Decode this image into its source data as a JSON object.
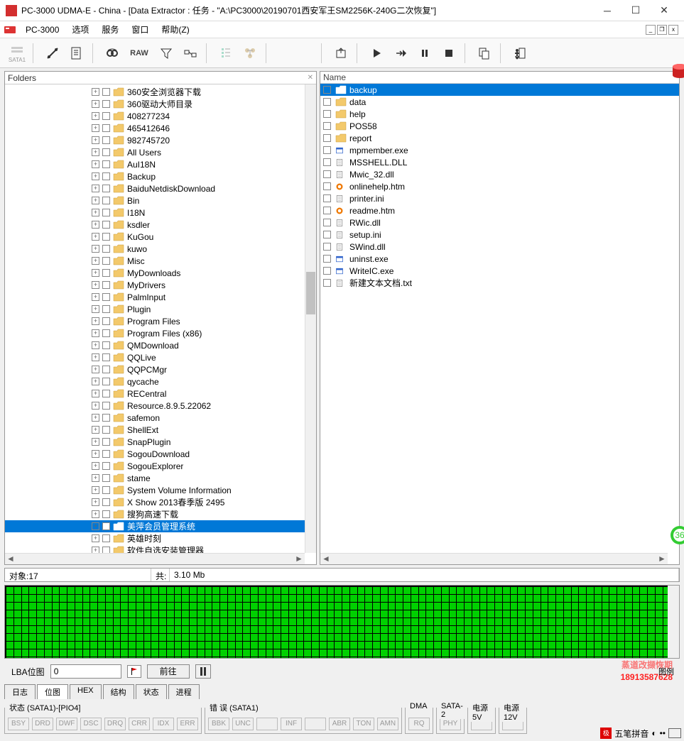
{
  "window": {
    "title": "PC-3000 UDMA-E - China - [Data Extractor : 任务 - \"A:\\PC3000\\20190701西安军王SM2256K-240G二次恢复\"]"
  },
  "menu": {
    "app": "PC-3000",
    "items": [
      "选项",
      "服务",
      "窗口",
      "帮助(Z)"
    ]
  },
  "toolbar_raw": "RAW",
  "folders_panel": {
    "title": "Folders"
  },
  "tree": [
    {
      "label": "360安全浏览器下载"
    },
    {
      "label": "360驱动大师目录"
    },
    {
      "label": "408277234"
    },
    {
      "label": "465412646"
    },
    {
      "label": "982745720"
    },
    {
      "label": "All Users"
    },
    {
      "label": "AuI18N"
    },
    {
      "label": "Backup"
    },
    {
      "label": "BaiduNetdiskDownload"
    },
    {
      "label": "Bin"
    },
    {
      "label": "I18N"
    },
    {
      "label": "ksdler"
    },
    {
      "label": "KuGou"
    },
    {
      "label": "kuwo"
    },
    {
      "label": "Misc"
    },
    {
      "label": "MyDownloads"
    },
    {
      "label": "MyDrivers"
    },
    {
      "label": "PalmInput"
    },
    {
      "label": "Plugin"
    },
    {
      "label": "Program Files"
    },
    {
      "label": "Program Files (x86)"
    },
    {
      "label": "QMDownload"
    },
    {
      "label": "QQLive"
    },
    {
      "label": "QQPCMgr"
    },
    {
      "label": "qycache"
    },
    {
      "label": "RECentral"
    },
    {
      "label": "Resource.8.9.5.22062"
    },
    {
      "label": "safemon"
    },
    {
      "label": "ShellExt"
    },
    {
      "label": "SnapPlugin"
    },
    {
      "label": "SogouDownload"
    },
    {
      "label": "SogouExplorer"
    },
    {
      "label": "stame"
    },
    {
      "label": "System Volume Information"
    },
    {
      "label": "X Show 2013春季版 2495"
    },
    {
      "label": "搜狗高速下载"
    },
    {
      "label": "美萍会员管理系统",
      "selected": true
    },
    {
      "label": "英雄时刻"
    },
    {
      "label": "软件自选安装管理器"
    }
  ],
  "list_header": "Name",
  "list": [
    {
      "name": "backup",
      "type": "folder",
      "selected": true
    },
    {
      "name": "data",
      "type": "folder"
    },
    {
      "name": "help",
      "type": "folder"
    },
    {
      "name": "POS58",
      "type": "folder"
    },
    {
      "name": "report",
      "type": "folder"
    },
    {
      "name": "mpmember.exe",
      "type": "exe"
    },
    {
      "name": "MSSHELL.DLL",
      "type": "dll"
    },
    {
      "name": "Mwic_32.dll",
      "type": "dll"
    },
    {
      "name": "onlinehelp.htm",
      "type": "htm"
    },
    {
      "name": "printer.ini",
      "type": "ini"
    },
    {
      "name": "readme.htm",
      "type": "htm"
    },
    {
      "name": "RWic.dll",
      "type": "dll"
    },
    {
      "name": "setup.ini",
      "type": "ini"
    },
    {
      "name": "SWind.dll",
      "type": "dll"
    },
    {
      "name": "uninst.exe",
      "type": "exe"
    },
    {
      "name": "WriteIC.exe",
      "type": "exe"
    },
    {
      "name": "新建文本文档.txt",
      "type": "txt"
    }
  ],
  "status": {
    "objects_label": "对象:",
    "objects_value": "17",
    "total_label": "共:",
    "total_value": "3.10 Mb"
  },
  "lba": {
    "label": "LBA位图",
    "value": "0",
    "go": "前往",
    "legend_right": "图例"
  },
  "watermark": {
    "line1": "蒸道改撷恢期",
    "phone": "18913587628"
  },
  "tabs": [
    "日志",
    "位图",
    "HEX",
    "结构",
    "状态",
    "进程"
  ],
  "active_tab": 1,
  "bottom": {
    "g1_label": "状态 (SATA1)-[PIO4]",
    "g1": [
      "BSY",
      "DRD",
      "DWF",
      "DSC",
      "DRQ",
      "CRR",
      "IDX",
      "ERR"
    ],
    "g2_label": "错 误 (SATA1)",
    "g2": [
      "BBK",
      "UNC",
      "",
      "INF",
      "",
      "ABR",
      "TON",
      "AMN"
    ],
    "g3_label": "DMA",
    "g3": [
      "RQ"
    ],
    "g4_label": "SATA-2",
    "g4": [
      "PHY"
    ],
    "g5_label": "电源 5V",
    "g6_label": "电源 12V"
  },
  "ime": "五笔拼音"
}
